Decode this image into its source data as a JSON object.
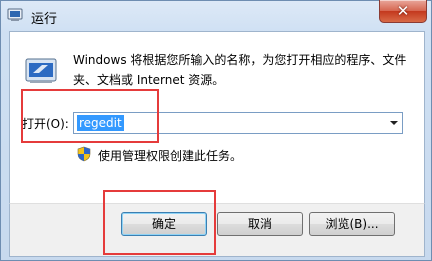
{
  "window": {
    "title": "运行"
  },
  "dialog": {
    "description": "Windows 将根据您所输入的名称，为您打开相应的程序、文件夹、文档或 Internet 资源。",
    "open_label": "打开(O):",
    "open_value": "regedit",
    "admin_note": "使用管理权限创建此任务。"
  },
  "buttons": {
    "ok": "确定",
    "cancel": "取消",
    "browse": "浏览(B)..."
  },
  "colors": {
    "highlight": "#e53b3b",
    "selection": "#3399ff",
    "close": "#c4381e"
  }
}
